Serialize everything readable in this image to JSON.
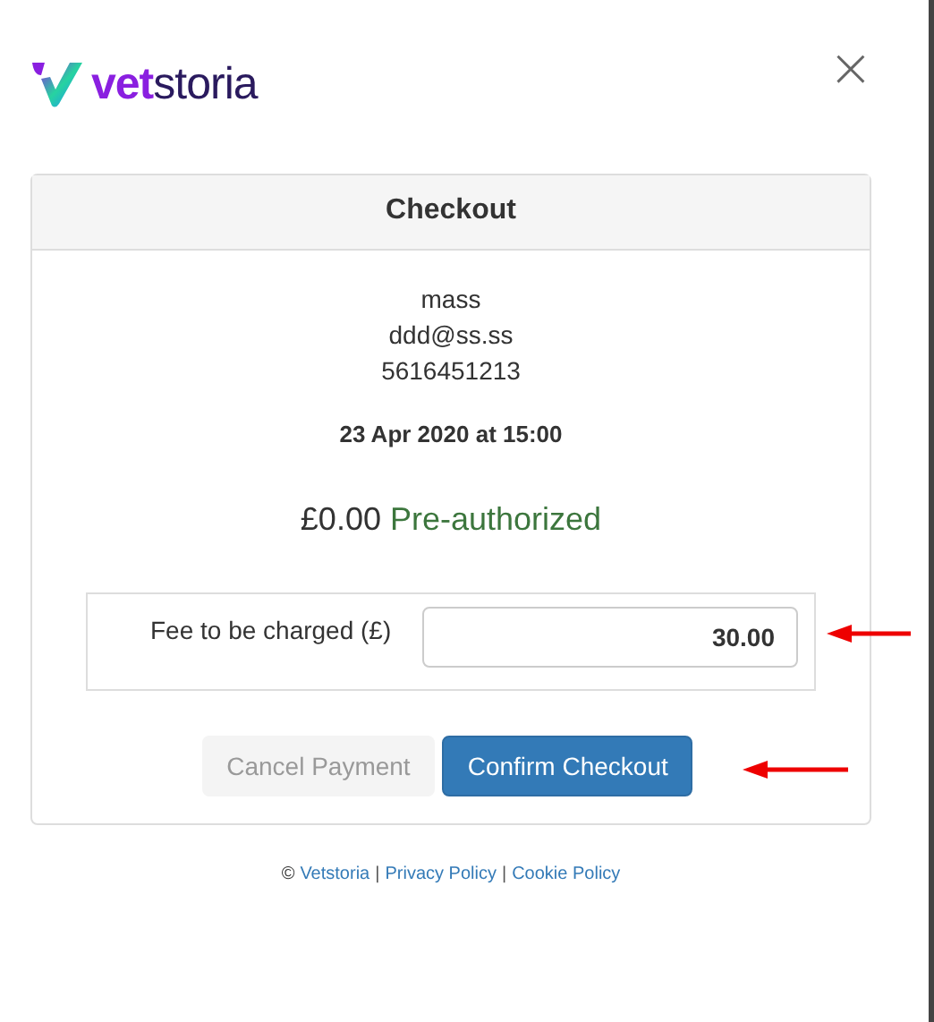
{
  "logo": {
    "prefix": "vet",
    "suffix": "storia"
  },
  "close": "×",
  "checkout": {
    "title": "Checkout",
    "name": "mass",
    "email": "ddd@ss.ss",
    "phone": "5616451213",
    "appointment": "23 Apr 2020 at 15:00",
    "amount": "£0.00",
    "status": "Pre-authorized",
    "fee_label": "Fee to be charged (£)",
    "fee_value": "30.00",
    "buttons": [
      {
        "label": "Cancel Payment",
        "kind": "secondary",
        "disabled": true
      },
      {
        "label": "Confirm Checkout",
        "kind": "primary",
        "disabled": false
      }
    ]
  },
  "footer": {
    "copyright": "©",
    "links": [
      "Vetstoria",
      "Privacy Policy",
      "Cookie Policy"
    ],
    "separator": "|"
  }
}
